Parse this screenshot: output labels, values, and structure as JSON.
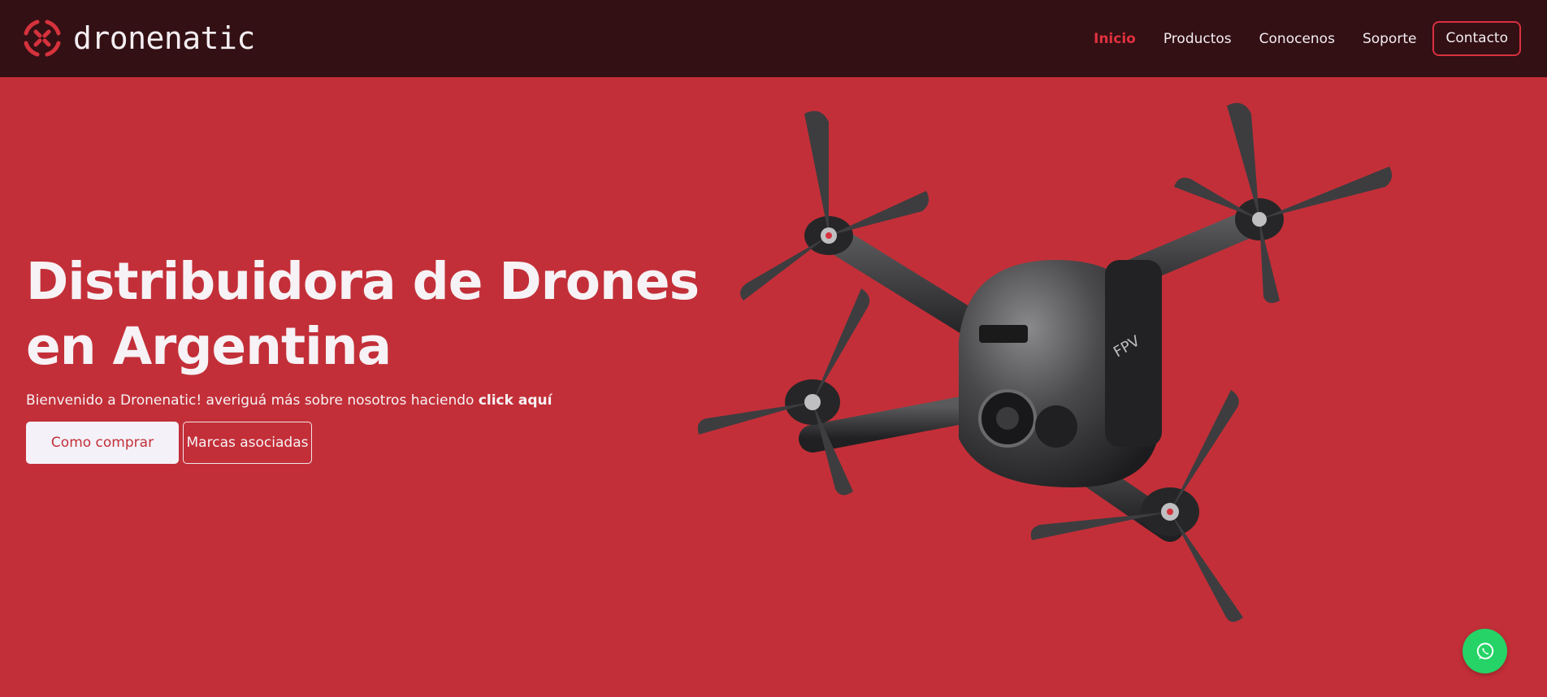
{
  "brand": {
    "name": "dronenatic",
    "accent": "#c32f38",
    "dark": "#331014",
    "icon": "drone-logo-icon"
  },
  "nav": {
    "items": [
      {
        "label": "Inicio",
        "active": true
      },
      {
        "label": "Productos",
        "active": false
      },
      {
        "label": "Conocenos",
        "active": false
      },
      {
        "label": "Soporte",
        "active": false
      }
    ],
    "contact_label": "Contacto"
  },
  "hero": {
    "title_line1": "Distribuidora de Drones",
    "title_line2": "en Argentina",
    "subtitle_prefix": "Bienvenido a Dronenatic! averiguá más sobre nosotros haciendo",
    "subtitle_link": "click aquí",
    "primary_button": "Como comprar",
    "secondary_button": "Marcas asociadas",
    "image": "fpv-drone-image",
    "drone_label": "FPV"
  },
  "whatsapp": {
    "icon": "whatsapp-icon",
    "color": "#25d366"
  }
}
